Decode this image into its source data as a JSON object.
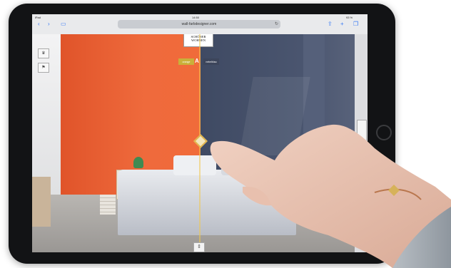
{
  "status_bar": {
    "left": "iPad",
    "time": "14:50",
    "battery": "93 %"
  },
  "safari": {
    "url": "wall-farbdesigner.com"
  },
  "room_app": {
    "logo_line1": "SCHÖNER",
    "logo_line2": "WOHNEN",
    "label_a": "orange",
    "ab_text": "A B",
    "label_b": "nebelblau"
  },
  "icons": [
    "bookmark-icon",
    "reload-icon",
    "share-icon",
    "plus-icon",
    "tabs-icon",
    "diamond-handle-icon",
    "tool-icon"
  ],
  "colors": {
    "wall_a": "#ee6436",
    "wall_b": "#465169",
    "divider": "#e2b64c"
  }
}
